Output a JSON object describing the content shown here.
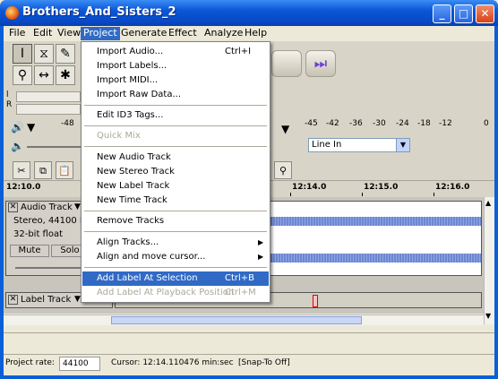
{
  "window": {
    "title": "Brothers_And_Sisters_2",
    "buttons": [
      "_",
      "□",
      "✕"
    ]
  },
  "menubar": {
    "items": [
      "File",
      "Edit",
      "View",
      "Project",
      "Generate",
      "Effect",
      "Analyze",
      "Help"
    ],
    "active": "Project"
  },
  "project_menu": [
    {
      "label": "Import Audio...",
      "shortcut": "Ctrl+I"
    },
    {
      "label": "Import Labels..."
    },
    {
      "label": "Import MIDI..."
    },
    {
      "label": "Import Raw Data..."
    },
    {
      "label": "Edit ID3 Tags..."
    },
    {
      "label": "Quick Mix",
      "disabled": true
    },
    {
      "label": "New Audio Track"
    },
    {
      "label": "New Stereo Track"
    },
    {
      "label": "New Label Track"
    },
    {
      "label": "New Time Track"
    },
    {
      "label": "Remove Tracks"
    },
    {
      "label": "Align Tracks...",
      "submenu": true
    },
    {
      "label": "Align and move cursor...",
      "submenu": true
    },
    {
      "label": "Add Label At Selection",
      "shortcut": "Ctrl+B",
      "highlighted": true
    },
    {
      "label": "Add Label At Playback Position",
      "shortcut": "Ctrl+M",
      "disabled": true
    }
  ],
  "meters": {
    "left_db": "-48",
    "input_scale": [
      "-45",
      "-42",
      "-36",
      "-30",
      "-24",
      "-18",
      "-12",
      "0"
    ]
  },
  "input_source": "Line In",
  "ruler": [
    "12:10.0",
    "12:14.0",
    "12:15.0",
    "12:16.0"
  ],
  "audio_track": {
    "name": "Audio Track",
    "info1": "Stereo, 44100 Hz",
    "info2": "32-bit float",
    "mute": "Mute",
    "solo": "Solo"
  },
  "label_track": {
    "name": "Label Track"
  },
  "status": {
    "rate_label": "Project rate:",
    "rate_value": "44100",
    "cursor_label": "Cursor: 12:14.110476 min:sec",
    "snap": "[Snap-To Off]"
  },
  "colors": {
    "title_bar": "#0a57d6",
    "menu_highlight": "#316ac5",
    "waveform": "#3b5fc4"
  }
}
